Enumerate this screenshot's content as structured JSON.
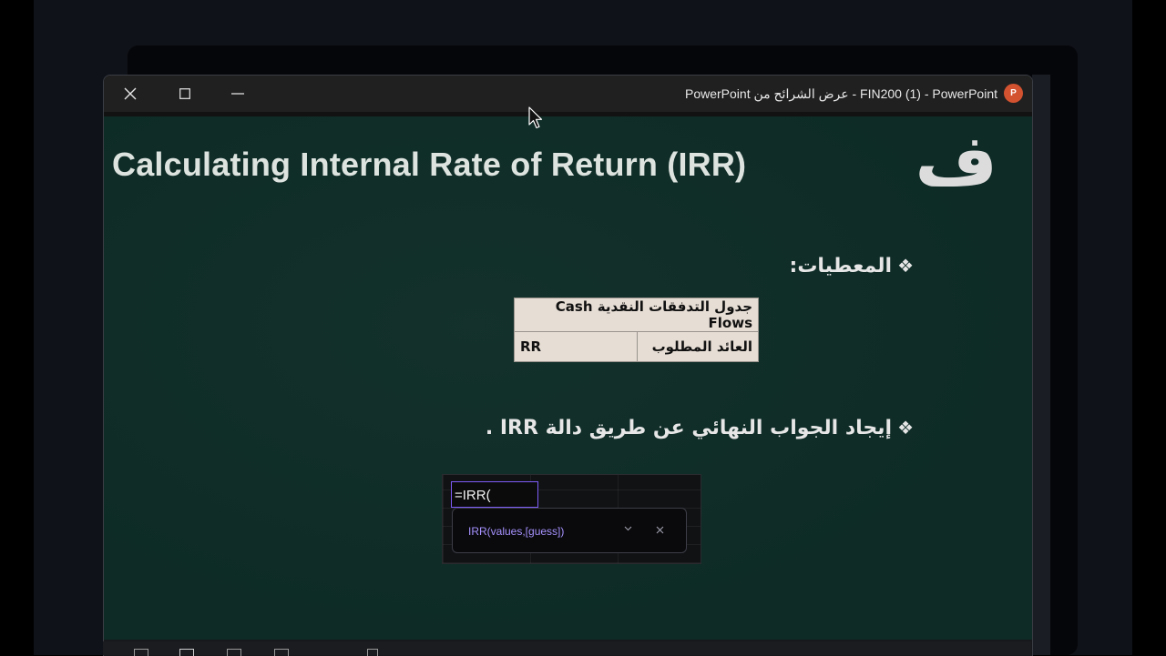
{
  "window": {
    "title": "PowerPoint عرض الشرائح من  -  FIN200 (1) - PowerPoint",
    "app_icon": "powerpoint-icon",
    "app_icon_letter": "P",
    "controls": [
      "close-icon",
      "maximize-icon",
      "minimize-icon"
    ]
  },
  "slide": {
    "title": "Calculating Internal Rate of Return (IRR)",
    "section_letter": "ف",
    "bullets": [
      {
        "symbol": "❖",
        "text": "المعطيات:"
      },
      {
        "symbol": "❖",
        "text": "إيجاد الجواب النهائي عن طريق دالة IRR ."
      }
    ],
    "givens_table": {
      "row1": "جدول التدفقات النقدية Cash Flows",
      "row2_left": "RR",
      "row2_right": "العائد المطلوب"
    }
  },
  "excel_snippet": {
    "cell_formula": "=IRR(",
    "tooltip_syntax": "IRR(values,[guess])"
  },
  "colors": {
    "slide_background": "#0e2b26",
    "title_text": "#dde3df",
    "table_background": "#e6ddd4",
    "tooltip_accent": "#a792ff",
    "cell_border": "#7d5cf5",
    "powerpoint_brand": "#d35230"
  }
}
